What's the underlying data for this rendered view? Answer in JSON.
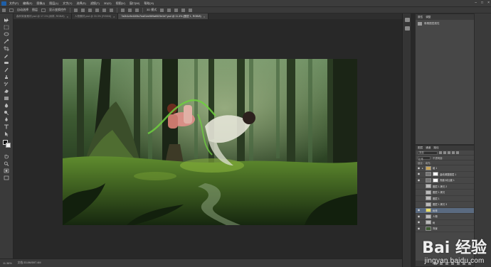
{
  "menu": {
    "items": [
      "文件(F)",
      "编辑(E)",
      "图像(I)",
      "图层(L)",
      "文字(Y)",
      "选择(S)",
      "滤镜(T)",
      "3D(D)",
      "视图(V)",
      "窗口(W)",
      "帮助(H)"
    ]
  },
  "options_bar": {
    "auto_select": "自动选择",
    "layer_mode": "图层",
    "show_transform": "显示变换控件",
    "mode_3d": "3D 模式"
  },
  "tabs": [
    {
      "label": "森林背景素材.psd @ 17.1% (树林, RGB/8)",
      "active": false
    },
    {
      "label": "人物素材.psd @ 33.3% (RGB/8)",
      "active": false
    },
    {
      "label": "7a2b1c9e4405c7ea01ee569a6523e1b7.psd @ 11.4% (图层 1, RGB/8)",
      "active": true
    }
  ],
  "status": {
    "zoom": "11.36%",
    "doc": "文档:33.8M/597.4M"
  },
  "properties_panel": {
    "tab1": "属性",
    "tab2": "调整",
    "row_label": "像素图层属性"
  },
  "layers_panel": {
    "tab_layers": "图层",
    "tab_channels": "通道",
    "tab_paths": "路径",
    "filter_kind": "类型",
    "blend_mode": "正常",
    "opacity_label": "不透明度:",
    "lock_label": "锁定:",
    "fill_label": "填充:",
    "layers": [
      {
        "name": "组 1",
        "type": "group",
        "selected": false
      },
      {
        "name": "曲线调整图层 1",
        "type": "adjust",
        "selected": false
      },
      {
        "name": "亮度/对比度 1",
        "type": "adjust",
        "selected": false
      },
      {
        "name": "图层 1 拷贝 2",
        "type": "pixel",
        "selected": false
      },
      {
        "name": "图层 1 拷贝",
        "type": "pixel",
        "selected": false
      },
      {
        "name": "图层 1",
        "type": "pixel",
        "selected": false
      },
      {
        "name": "图层 1 拷贝 3",
        "type": "pixel",
        "selected": false
      },
      {
        "name": "树林",
        "type": "pixel",
        "selected": true
      },
      {
        "name": "人物",
        "type": "pixel",
        "selected": false
      },
      {
        "name": "树",
        "type": "pixel",
        "selected": false
      },
      {
        "name": "背景",
        "type": "pixel",
        "selected": false
      }
    ]
  },
  "watermark": {
    "logo": "Bai 经验",
    "url": "jingyan.baidu.com"
  },
  "colors": {
    "app_bg": "#282828",
    "panel": "#474747",
    "accent_selected": "#5a6a80",
    "forest_dark": "#1a2a16",
    "moss": "#4f7a2a"
  }
}
